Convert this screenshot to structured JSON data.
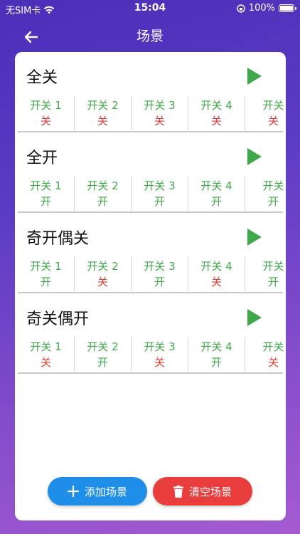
{
  "status": {
    "carrier": "无SIM卡",
    "time": "15:04",
    "battery": "100%"
  },
  "nav": {
    "title": "场景"
  },
  "colors": {
    "on": "#3fa84a",
    "off": "#e53935",
    "add_button": "#1e8ee8",
    "clear_button": "#ea3d3d"
  },
  "scenes": [
    {
      "name": "全关",
      "switches": [
        {
          "label": "开关 1",
          "state": "关"
        },
        {
          "label": "开关 2",
          "state": "关"
        },
        {
          "label": "开关 3",
          "state": "关"
        },
        {
          "label": "开关 4",
          "state": "关"
        },
        {
          "label": "开关",
          "state": "关"
        }
      ]
    },
    {
      "name": "全开",
      "switches": [
        {
          "label": "开关 1",
          "state": "开"
        },
        {
          "label": "开关 2",
          "state": "开"
        },
        {
          "label": "开关 3",
          "state": "开"
        },
        {
          "label": "开关 4",
          "state": "开"
        },
        {
          "label": "开关",
          "state": "开"
        }
      ]
    },
    {
      "name": "奇开偶关",
      "switches": [
        {
          "label": "开关 1",
          "state": "开"
        },
        {
          "label": "开关 2",
          "state": "关"
        },
        {
          "label": "开关 3",
          "state": "开"
        },
        {
          "label": "开关 4",
          "state": "关"
        },
        {
          "label": "开关",
          "state": "开"
        }
      ]
    },
    {
      "name": "奇关偶开",
      "switches": [
        {
          "label": "开关 1",
          "state": "关"
        },
        {
          "label": "开关 2",
          "state": "开"
        },
        {
          "label": "开关 3",
          "state": "关"
        },
        {
          "label": "开关 4",
          "state": "开"
        },
        {
          "label": "开关",
          "state": "关"
        }
      ]
    }
  ],
  "actions": {
    "add_label": "添加场景",
    "clear_label": "清空场景"
  }
}
